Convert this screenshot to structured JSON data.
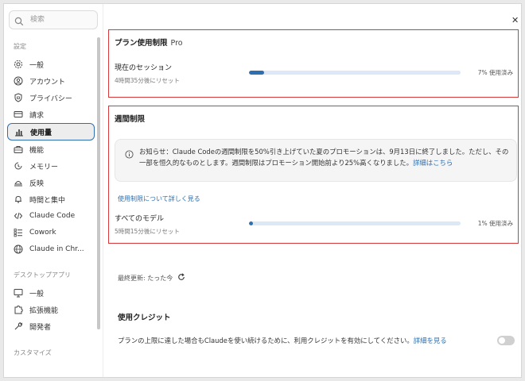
{
  "sidebar": {
    "search_placeholder": "検索",
    "section_settings": "設定",
    "items": [
      {
        "label": "一般",
        "icon": "gear-icon"
      },
      {
        "label": "アカウント",
        "icon": "user-circle-icon"
      },
      {
        "label": "プライバシー",
        "icon": "shield-icon"
      },
      {
        "label": "請求",
        "icon": "credit-card-icon"
      },
      {
        "label": "使用量",
        "icon": "bar-chart-icon"
      },
      {
        "label": "機能",
        "icon": "toolbox-icon"
      },
      {
        "label": "メモリー",
        "icon": "memory-icon"
      },
      {
        "label": "反映",
        "icon": "lamp-icon"
      },
      {
        "label": "時間と集中",
        "icon": "bell-icon"
      },
      {
        "label": "Claude Code",
        "icon": "code-icon"
      },
      {
        "label": "Cowork",
        "icon": "checklist-icon"
      },
      {
        "label": "Claude in Chr...",
        "icon": "globe-icon"
      }
    ],
    "section_desktop": "デスクトップアプリ",
    "desktop_items": [
      {
        "label": "一般",
        "icon": "monitor-icon"
      },
      {
        "label": "拡張機能",
        "icon": "puzzle-icon"
      },
      {
        "label": "開発者",
        "icon": "wrench-icon"
      }
    ],
    "section_customize": "カスタマイズ",
    "active_index": 4
  },
  "plan": {
    "title": "プラン使用制限",
    "badge": "Pro",
    "session_label": "現在のセッション",
    "session_reset": "4時間35分後にリセット",
    "session_pct_text": "7% 使用済み",
    "session_fraction": 0.07
  },
  "weekly": {
    "title": "週間制限",
    "notice_text": "お知らせ：Claude Codeの週間制限を50%引き上げていた夏のプロモーションは、9月13日に終了しました。ただし、その一部を恒久的なものとします。週間制限はプロモーション開始前より25%高くなりました。",
    "notice_link": "詳細はこちら",
    "learn_more": "使用制限について詳しく見る",
    "all_models_label": "すべてのモデル",
    "all_models_reset": "5時間15分後にリセット",
    "all_models_pct_text": "1% 使用済み",
    "all_models_fraction": 0.01
  },
  "last_updated": "最終更新: たった今",
  "credits": {
    "title": "使用クレジット",
    "description": "プランの上限に達した場合もClaudeを使い続けるために、利用クレジットを有効にしてください。",
    "link": "詳細を見る",
    "toggle_on": false
  },
  "colors": {
    "accent": "#2e6fb0",
    "highlight_border": "#d63a3a"
  }
}
